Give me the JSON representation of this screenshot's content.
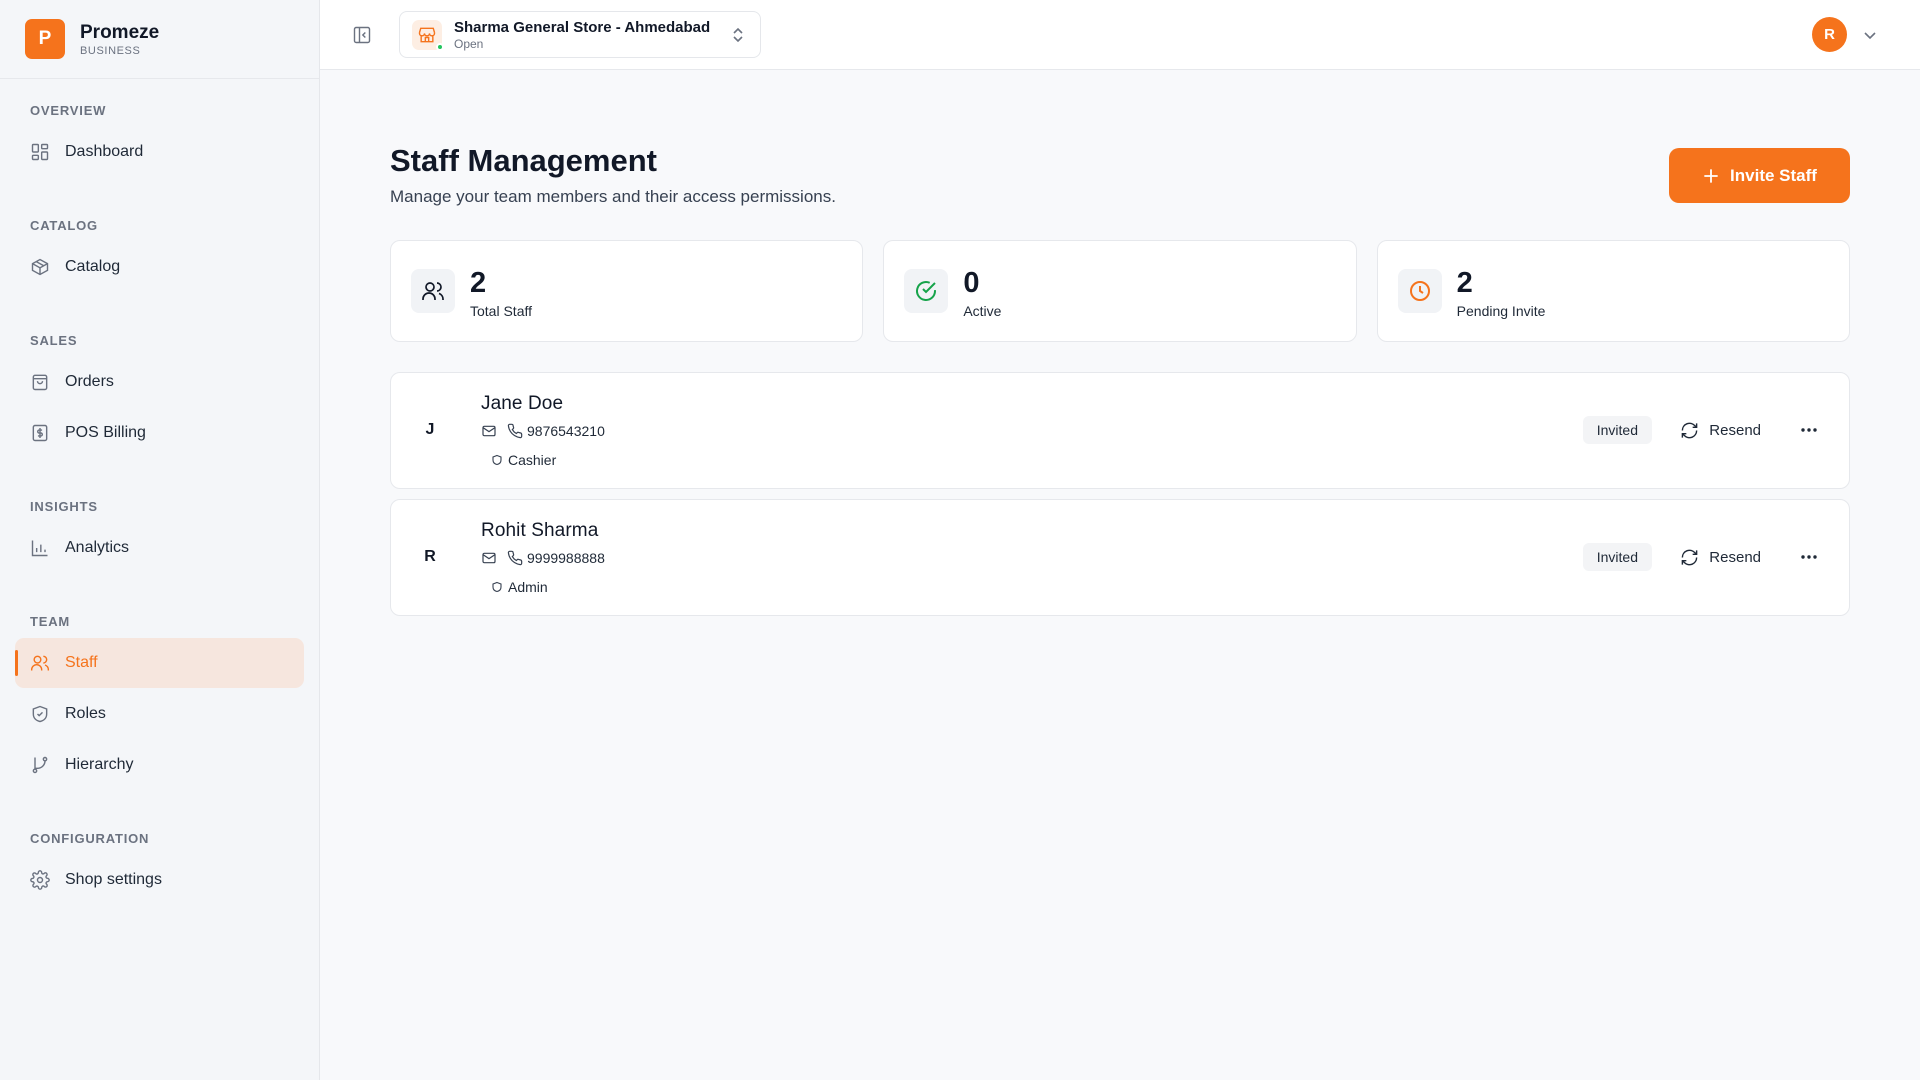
{
  "brand": {
    "logo_letter": "P",
    "name": "Promeze",
    "subtitle": "BUSINESS",
    "accent": "#f5731c"
  },
  "sidebar": {
    "sections": [
      {
        "title": "OVERVIEW",
        "items": [
          {
            "label": "Dashboard",
            "icon": "grid-icon",
            "active": false
          }
        ]
      },
      {
        "title": "CATALOG",
        "items": [
          {
            "label": "Catalog",
            "icon": "box-icon",
            "active": false
          }
        ]
      },
      {
        "title": "SALES",
        "items": [
          {
            "label": "Orders",
            "icon": "bag-icon",
            "active": false
          },
          {
            "label": "POS Billing",
            "icon": "receipt-icon",
            "active": false
          }
        ]
      },
      {
        "title": "INSIGHTS",
        "items": [
          {
            "label": "Analytics",
            "icon": "bar-chart-icon",
            "active": false
          }
        ]
      },
      {
        "title": "TEAM",
        "items": [
          {
            "label": "Staff",
            "icon": "users-icon",
            "active": true
          },
          {
            "label": "Roles",
            "icon": "shield-icon",
            "active": false
          },
          {
            "label": "Hierarchy",
            "icon": "git-branch-icon",
            "active": false
          }
        ]
      },
      {
        "title": "CONFIGURATION",
        "items": [
          {
            "label": "Shop settings",
            "icon": "gear-icon",
            "active": false
          }
        ]
      }
    ]
  },
  "topbar": {
    "store_name": "Sharma General Store - Ahmedabad",
    "store_status": "Open",
    "user_initial": "R"
  },
  "page": {
    "title": "Staff Management",
    "subtitle": "Manage your team members and their access permissions.",
    "invite_label": "Invite Staff"
  },
  "stats": [
    {
      "value": "2",
      "label": "Total Staff",
      "icon": "users-icon",
      "color": "#111827"
    },
    {
      "value": "0",
      "label": "Active",
      "icon": "check-circle-icon",
      "color": "#16a34a"
    },
    {
      "value": "2",
      "label": "Pending Invite",
      "icon": "clock-icon",
      "color": "#f5731c"
    }
  ],
  "staff": [
    {
      "initial": "J",
      "name": "Jane Doe",
      "phone": "9876543210",
      "role": "Cashier",
      "status": "Invited",
      "action": "Resend"
    },
    {
      "initial": "R",
      "name": "Rohit Sharma",
      "phone": "9999988888",
      "role": "Admin",
      "status": "Invited",
      "action": "Resend"
    }
  ]
}
